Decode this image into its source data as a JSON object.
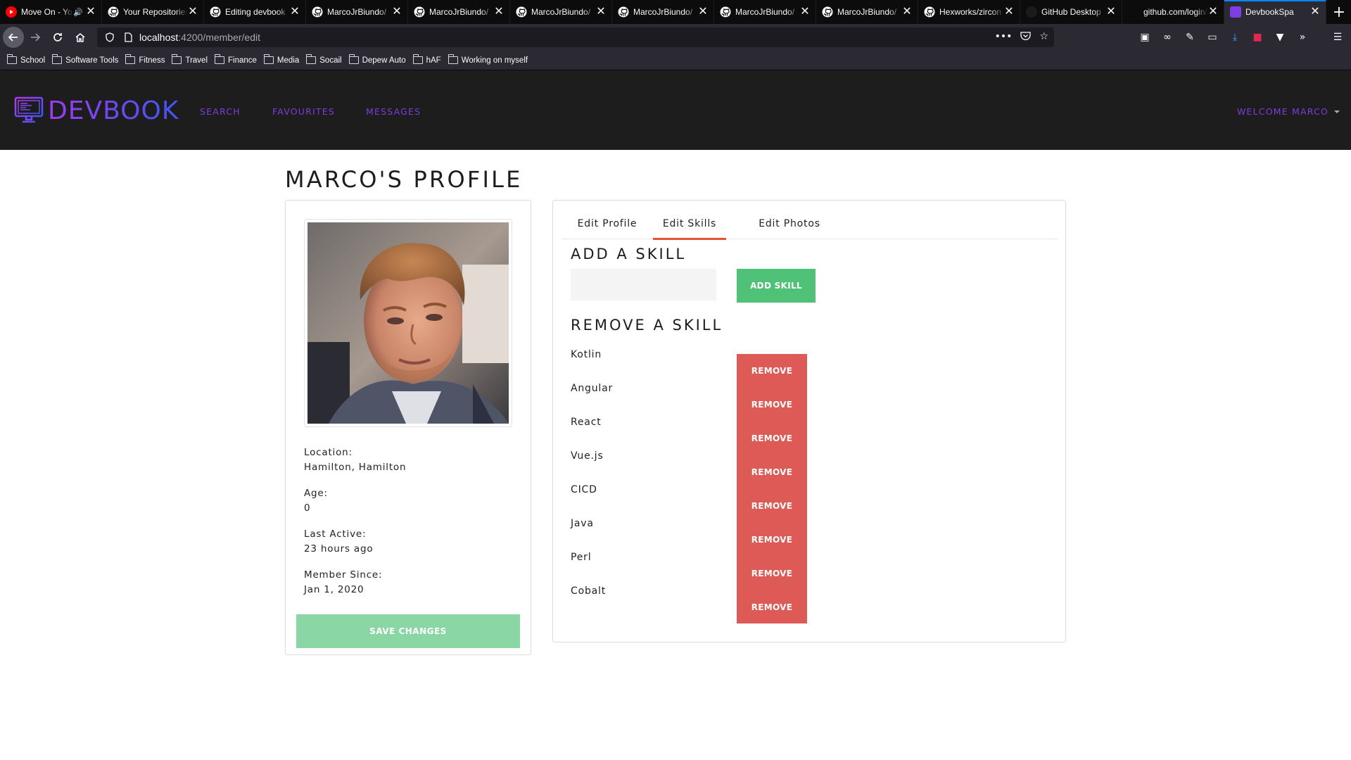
{
  "browser": {
    "tabs": [
      {
        "title": "Move On - Yo",
        "icon": "youtube-icon",
        "audio": true
      },
      {
        "title": "Your Repositories",
        "icon": "github-icon"
      },
      {
        "title": "Editing devbook",
        "icon": "github-icon"
      },
      {
        "title": "MarcoJrBiundo/",
        "icon": "github-icon"
      },
      {
        "title": "MarcoJrBiundo/",
        "icon": "github-icon"
      },
      {
        "title": "MarcoJrBiundo/",
        "icon": "github-icon"
      },
      {
        "title": "MarcoJrBiundo/",
        "icon": "github-icon"
      },
      {
        "title": "MarcoJrBiundo/",
        "icon": "github-icon"
      },
      {
        "title": "MarcoJrBiundo/",
        "icon": "github-icon"
      },
      {
        "title": "Hexworks/zircon",
        "icon": "github-icon"
      },
      {
        "title": "GitHub Desktop",
        "icon": "github-desktop-icon"
      },
      {
        "title": "github.com/login/oa",
        "icon": "none"
      },
      {
        "title": "DevbookSpa",
        "icon": "devbook-icon",
        "active": true
      }
    ],
    "url": {
      "host": "localhost",
      "path": ":4200/member/edit"
    },
    "bookmarks": [
      "School",
      "Software Tools",
      "Fitness",
      "Travel",
      "Finance",
      "Media",
      "Socail",
      "Depew Auto",
      "hAF",
      "Working on myself"
    ]
  },
  "header": {
    "brand": "DEVBOOK",
    "nav": {
      "search": "SEARCH",
      "favourites": "FAVOURITES",
      "messages": "MESSAGES"
    },
    "welcome": "WELCOME MARCO"
  },
  "page": {
    "title": "MARCO'S PROFILE"
  },
  "profile": {
    "location_label": "Location:",
    "location_value": "Hamilton, Hamilton",
    "age_label": "Age:",
    "age_value": "0",
    "last_active_label": "Last Active:",
    "last_active_value": "23 hours ago",
    "member_since_label": "Member Since:",
    "member_since_value": "Jan 1, 2020",
    "save_label": "SAVE CHANGES"
  },
  "tabs": {
    "edit_profile": "Edit Profile",
    "edit_skills": "Edit Skills",
    "edit_photos": "Edit Photos",
    "active": "edit_skills"
  },
  "skills": {
    "add_heading": "ADD A SKILL",
    "input_value": "",
    "add_button": "ADD SKILL",
    "remove_heading": "REMOVE A SKILL",
    "remove_button": "REMOVE",
    "items": [
      "Kotlin",
      "Angular",
      "React",
      "Vue.js",
      "CICD",
      "Java",
      "Perl",
      "Cobalt"
    ]
  },
  "colors": {
    "header_bg": "#1d1d1d",
    "nav_purple": "#7c3ddd",
    "add_green": "#4fc277",
    "save_green_disabled": "#8bd6a5",
    "remove_red": "#dd5a57",
    "active_tab_underline": "#e35336"
  }
}
